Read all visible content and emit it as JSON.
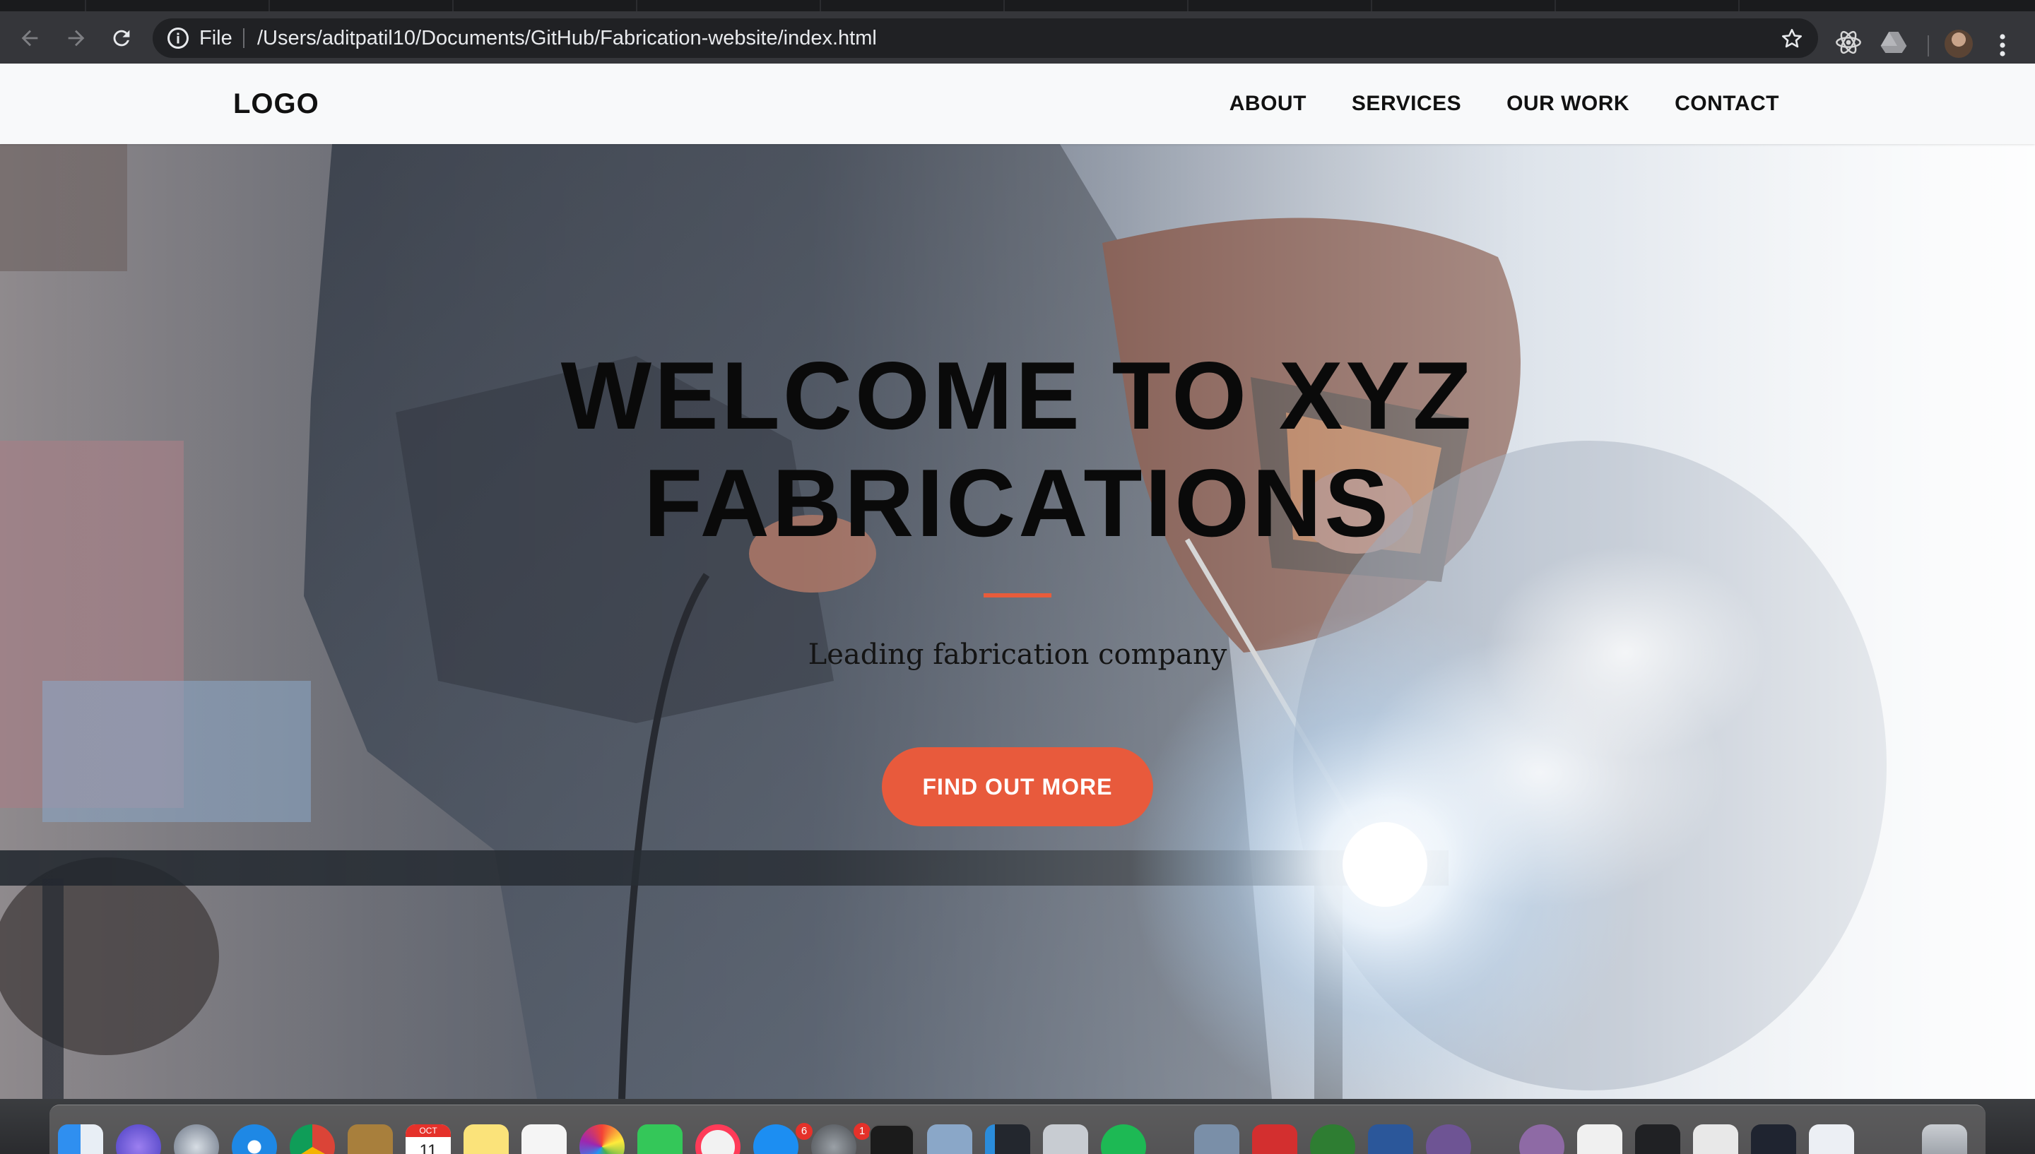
{
  "browser": {
    "scheme_label": "File",
    "url": "/Users/aditpatil10/Documents/GitHub/Fabrication-website/index.html",
    "icons": [
      "back-arrow-icon",
      "forward-arrow-icon",
      "reload-icon",
      "info-icon",
      "star-icon",
      "react-devtools-icon",
      "google-drive-icon",
      "profile-avatar",
      "menu-kebab-icon"
    ]
  },
  "site": {
    "logo": "LOGO",
    "nav": [
      "ABOUT",
      "SERVICES",
      "OUR WORK",
      "CONTACT"
    ],
    "hero": {
      "title_line1": "WELCOME TO XYZ",
      "title_line2": "FABRICATIONS",
      "subtitle": "Leading fabrication company",
      "cta": "FIND OUT MORE"
    }
  },
  "dock": {
    "badges": [
      "6",
      "1"
    ],
    "calendar_month": "OCT",
    "calendar_day": "11"
  },
  "colors": {
    "accent": "#e85a3c",
    "navbar_bg": "#f8f9fa",
    "chrome_bg": "#35363a",
    "omnibox_bg": "#202124"
  }
}
